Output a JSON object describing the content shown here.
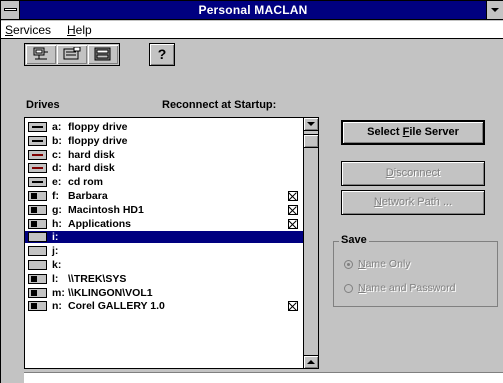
{
  "window": {
    "title": "Personal MACLAN"
  },
  "menu": {
    "services": {
      "hotkey": "S",
      "rest": "ervices"
    },
    "help": {
      "hotkey": "H",
      "rest": "elp"
    }
  },
  "toolbar": {
    "help_label": "?"
  },
  "labels": {
    "drives": "Drives",
    "reconnect": "Reconnect at Startup:"
  },
  "drives": [
    {
      "letter": "a:",
      "name": "floppy drive",
      "icon": "floppy-drive-icon",
      "reconnect": false,
      "selected": false
    },
    {
      "letter": "b:",
      "name": "floppy drive",
      "icon": "floppy-drive-icon",
      "reconnect": false,
      "selected": false
    },
    {
      "letter": "c:",
      "name": "hard disk",
      "icon": "hard-disk-icon",
      "reconnect": false,
      "selected": false
    },
    {
      "letter": "d:",
      "name": "hard disk",
      "icon": "hard-disk-icon",
      "reconnect": false,
      "selected": false
    },
    {
      "letter": "e:",
      "name": "cd rom",
      "icon": "cd-rom-icon",
      "reconnect": false,
      "selected": false
    },
    {
      "letter": "f:",
      "name": "Barbara",
      "icon": "network-drive-icon",
      "reconnect": true,
      "selected": false
    },
    {
      "letter": "g:",
      "name": "Macintosh HD1",
      "icon": "network-drive-icon",
      "reconnect": true,
      "selected": false
    },
    {
      "letter": "h:",
      "name": " Applications",
      "icon": "network-drive-icon",
      "reconnect": true,
      "selected": false
    },
    {
      "letter": "i:",
      "name": "",
      "icon": "empty-drive-icon",
      "reconnect": false,
      "selected": true
    },
    {
      "letter": "j:",
      "name": "",
      "icon": "empty-drive-icon",
      "reconnect": false,
      "selected": false
    },
    {
      "letter": "k:",
      "name": "",
      "icon": "empty-drive-icon",
      "reconnect": false,
      "selected": false
    },
    {
      "letter": "l:",
      "name": "\\\\TREK\\SYS",
      "icon": "network-drive-icon",
      "reconnect": false,
      "selected": false
    },
    {
      "letter": "m:",
      "name": "\\\\KLINGON\\VOL1",
      "icon": "network-drive-icon",
      "reconnect": false,
      "selected": false
    },
    {
      "letter": "n:",
      "name": "Corel GALLERY 1.0",
      "icon": "network-drive-icon",
      "reconnect": true,
      "selected": false
    }
  ],
  "buttons": {
    "select_file_server": {
      "pre": "Select ",
      "hotkey": "F",
      "post": "ile Server"
    },
    "disconnect": {
      "pre": "",
      "hotkey": "D",
      "post": "isconnect"
    },
    "network_path": {
      "pre": "",
      "hotkey": "N",
      "post": "etwork Path ..."
    }
  },
  "save": {
    "title": "Save",
    "name_only": {
      "hotkey": "N",
      "rest": "ame Only",
      "checked": true
    },
    "name_and_password": {
      "hotkey": "N",
      "rest": "ame and Password",
      "checked": false
    }
  }
}
